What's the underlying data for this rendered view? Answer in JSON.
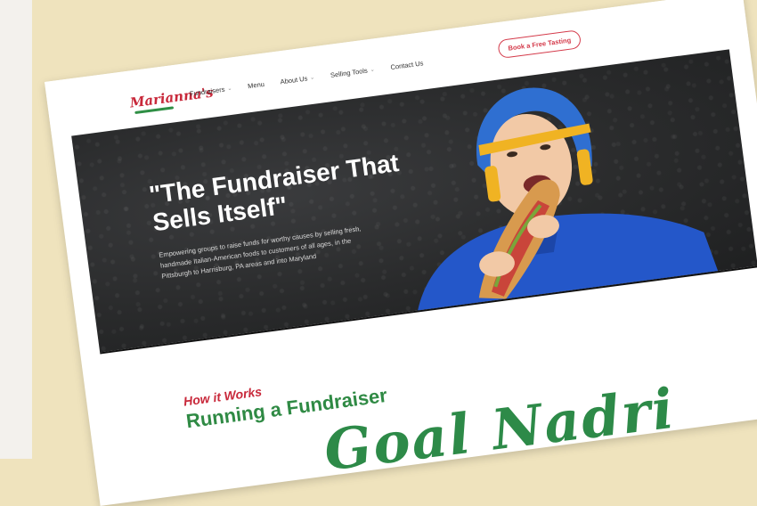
{
  "site": {
    "logo_text": "Marianna's",
    "nav": [
      {
        "label": "Fundraisers",
        "has_dropdown": true
      },
      {
        "label": "Menu",
        "has_dropdown": false
      },
      {
        "label": "About Us",
        "has_dropdown": true
      },
      {
        "label": "Selling Tools",
        "has_dropdown": true
      },
      {
        "label": "Contact Us",
        "has_dropdown": false
      }
    ],
    "cta_label": "Book a Free Tasting"
  },
  "hero": {
    "title": "\"The Fundraiser That Sells Itself\"",
    "subtitle": "Empowering groups to raise funds for worthy causes by selling fresh, handmade Italian-American foods to customers of all ages, in the Pittsburgh to Harrisburg, PA areas and into Maryland"
  },
  "how_it_works": {
    "label": "How it Works",
    "title": "Running a Fundraiser"
  },
  "overlay_script": "Goal Nadri",
  "colors": {
    "brand_red": "#c8283a",
    "brand_green": "#2f8a44",
    "background": "#efe3bd",
    "hero_bg": "#2a2b2c"
  }
}
